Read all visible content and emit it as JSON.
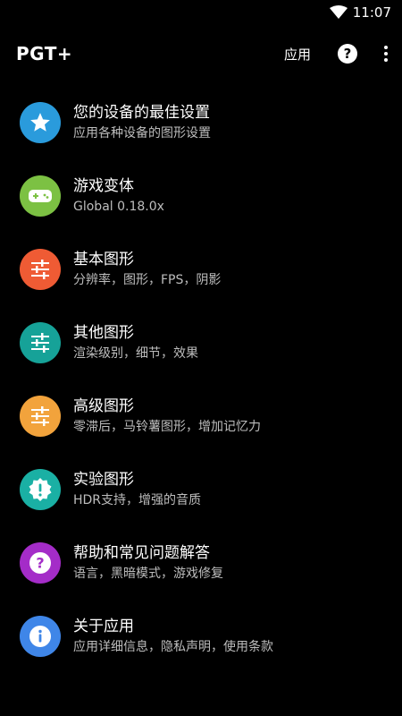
{
  "status_bar": {
    "time": "11:07",
    "wifi_icon": "wifi-icon"
  },
  "app_bar": {
    "title": "PGT+",
    "action_label": "应用",
    "help_icon": "help-icon",
    "more_icon": "more-vert-icon"
  },
  "menu": {
    "items": [
      {
        "title": "您的设备的最佳设置",
        "subtitle": "应用各种设备的图形设置",
        "icon": "star-icon",
        "color": "#2a9bdc"
      },
      {
        "title": "游戏变体",
        "subtitle": "Global 0.18.0x",
        "icon": "gamepad-icon",
        "color": "#7cc143"
      },
      {
        "title": "基本图形",
        "subtitle": "分辨率，图形，FPS，阴影",
        "icon": "sliders-icon",
        "color": "#ef5b34"
      },
      {
        "title": "其他图形",
        "subtitle": "渲染级别，细节，效果",
        "icon": "sliders-icon",
        "color": "#16a298"
      },
      {
        "title": "高级图形",
        "subtitle": "零滞后，马铃薯图形，增加记忆力",
        "icon": "sliders-icon",
        "color": "#f2a33c"
      },
      {
        "title": "实验图形",
        "subtitle": "HDR支持，增强的音质",
        "icon": "badge-alert-icon",
        "color": "#1ab0a4"
      },
      {
        "title": "帮助和常见问题解答",
        "subtitle": "语言，黑暗模式，游戏修复",
        "icon": "help-icon",
        "color": "#a42cc8"
      },
      {
        "title": "关于应用",
        "subtitle": "应用详细信息，隐私声明，使用条款",
        "icon": "info-icon",
        "color": "#3f86e8"
      }
    ]
  }
}
